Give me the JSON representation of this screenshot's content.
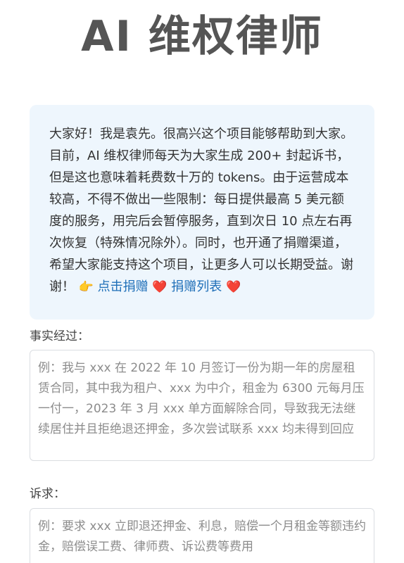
{
  "header": {
    "title": "AI 维权律师"
  },
  "notice": {
    "message": "大家好！我是袁先。很高兴这个项目能够帮助到大家。目前，AI 维权律师每天为大家生成 200+ 封起诉书，但是这也意味着耗费数十万的 tokens。由于运营成本较高，不得不做出一些限制：每日提供最高 5 美元额度的服务，用完后会暂停服务，直到次日 10 点左右再次恢复（特殊情况除外）。同时，也开通了捐赠渠道，希望大家能支持这个项目，让更多人可以长期受益。谢谢！",
    "donate_link": "点击捐赠",
    "donation_list_link": "捐赠列表",
    "pointer_icon": "👉",
    "heart_icon": "❤️"
  },
  "facts": {
    "label": "事实经过：",
    "placeholder": "例：我与 xxx 在 2022 年 10 月签订一份为期一年的房屋租赁合同，其中我为租户、xxx 为中介，租金为 6300 元每月压一付一，2023 年 3 月 xxx 单方面解除合同，导致我无法继续居住并且拒绝退还押金，多次尝试联系 xxx 均未得到回应",
    "value": ""
  },
  "claims": {
    "label": "诉求：",
    "placeholder": "例：要求 xxx 立即退还押金、利息，赔偿一个月租金等额违约金，赔偿误工费、律师费、诉讼费等费用",
    "value": ""
  },
  "colors": {
    "notice_background": "#eef6fd",
    "link": "#1f6fb8",
    "heart": "#e8385a",
    "title": "#555555"
  }
}
